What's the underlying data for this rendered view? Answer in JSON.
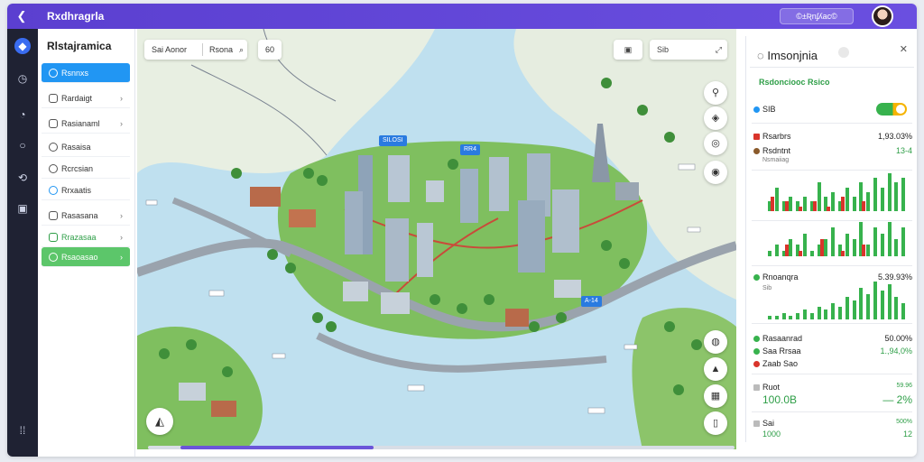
{
  "app": {
    "title": "Rxdhragrla",
    "top_button": "©±Ʀnʄʎaᴄ©",
    "back_icon": "chevron-left-icon",
    "avatar": "user-avatar"
  },
  "rail": {
    "items": [
      "logo-icon",
      "clock-icon",
      "chat-icon",
      "comment-icon",
      "share-icon",
      "image-icon",
      "grid-icon"
    ]
  },
  "sidenav": {
    "title": "Rlstajramica",
    "items": [
      {
        "label": "Rsnnxs",
        "icon": "circle-icon",
        "has_chevron": false,
        "style": "active"
      },
      {
        "label": "Rardaigt",
        "icon": "box-icon",
        "has_chevron": true,
        "style": "normal"
      },
      {
        "label": "Rasianaml",
        "icon": "box-icon",
        "has_chevron": true,
        "style": "normal"
      },
      {
        "label": "Rasaisa",
        "icon": "clock-icon",
        "has_chevron": false,
        "style": "normal"
      },
      {
        "label": "Rcrcsian",
        "icon": "smile-icon",
        "has_chevron": false,
        "style": "normal"
      },
      {
        "label": "Rrxaatis",
        "icon": "circle-icon",
        "has_chevron": false,
        "style": "normal"
      },
      {
        "label": "Rasasana",
        "icon": "box-icon",
        "has_chevron": true,
        "style": "normal"
      },
      {
        "label": "Rrazasaa",
        "icon": "check-icon",
        "has_chevron": true,
        "style": "green-text"
      },
      {
        "label": "Rsaoasao",
        "icon": "circle-icon",
        "has_chevron": true,
        "style": "green"
      }
    ]
  },
  "map": {
    "search_placeholder": "Sai Aonor",
    "search_secondary": "Rsona",
    "search_icon": "search-icon",
    "go_label": "60",
    "tool_right": "Sib",
    "tool_right_icon": "expand-icon",
    "tool_left_icon": "image-icon",
    "tags": [
      "SILOSI",
      "RR4",
      "A-14"
    ],
    "fabs_right": [
      "pin-icon",
      "layers-icon",
      "compass-icon",
      "location-icon"
    ],
    "fabs_bottom": [
      "target-icon",
      "building-icon",
      "grid-icon",
      "trash-icon"
    ],
    "fab_corner": "navigate-icon"
  },
  "panel": {
    "title": "Imsonjnia",
    "title_icon": "search-icon",
    "section_label": "Rsdonciooc Rsico",
    "toggle_label": "SIB",
    "metrics": [
      {
        "label": "Rsarbrs",
        "value": "1,93.03%",
        "color": "#d9342b"
      },
      {
        "label": "Rsdntnt",
        "value": "13-4",
        "sub": "Nsmaiiag",
        "color": "#8a5a2b"
      }
    ],
    "chart1": {
      "type": "bar",
      "series": [
        {
          "values": [
            2,
            5,
            2,
            3,
            2,
            3,
            2,
            6,
            3,
            4,
            2,
            5,
            3,
            6,
            4,
            7,
            5,
            8,
            6,
            7
          ],
          "color": "#37b24d"
        },
        {
          "values": [
            3,
            0,
            2,
            0,
            1,
            0,
            2,
            0,
            1,
            0,
            3,
            0,
            0,
            2,
            0,
            0,
            0,
            0,
            0,
            0
          ],
          "color": "#d9342b"
        }
      ]
    },
    "chart2": {
      "type": "bar",
      "series": [
        {
          "values": [
            1,
            2,
            1,
            3,
            2,
            4,
            1,
            2,
            3,
            5,
            2,
            4,
            3,
            6,
            2,
            5,
            4,
            6,
            3,
            5
          ],
          "color": "#37b24d"
        },
        {
          "values": [
            0,
            0,
            2,
            0,
            1,
            0,
            0,
            3,
            0,
            0,
            1,
            0,
            0,
            2,
            0,
            0,
            0,
            0,
            0,
            0
          ],
          "color": "#d9342b"
        }
      ]
    },
    "metric3": {
      "label": "Rnoanqra",
      "value": "5.39.93%",
      "sub": "Sib"
    },
    "chart3": {
      "type": "bar",
      "series": [
        {
          "values": [
            1,
            1,
            2,
            1,
            2,
            3,
            2,
            4,
            3,
            5,
            4,
            7,
            6,
            10,
            8,
            12,
            9,
            11,
            7,
            5
          ],
          "color": "#37b24d"
        }
      ]
    },
    "list": [
      {
        "label": "Rasaanrad",
        "value": "50.00%",
        "color": "#37b24d"
      },
      {
        "label": "Saa Rrsaa",
        "value": "1.,94,0%",
        "color": "#37b24d"
      },
      {
        "label": "Zaab Sao",
        "value": "",
        "color": "#d9342b"
      }
    ],
    "totals": [
      {
        "label": "Ruot",
        "value": "100.0B",
        "right_top": "59.96",
        "right": "— 2%"
      },
      {
        "label": "Sai",
        "value": "1000",
        "right_top": "500%",
        "right": "12"
      }
    ]
  }
}
